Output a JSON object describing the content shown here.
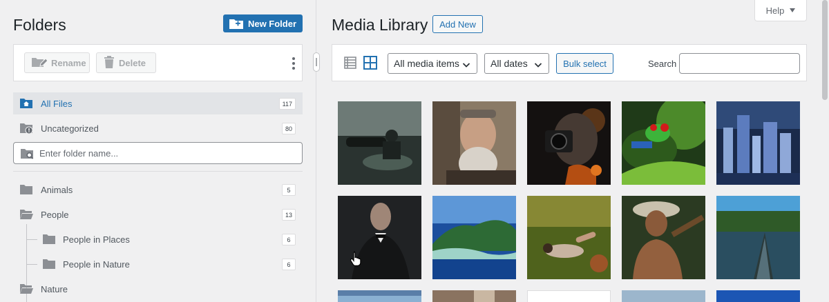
{
  "folders": {
    "title": "Folders",
    "new_folder_label": "New Folder",
    "toolbar": {
      "rename_label": "Rename",
      "delete_label": "Delete"
    },
    "all_files": {
      "label": "All Files",
      "count": "117"
    },
    "uncategorized": {
      "label": "Uncategorized",
      "count": "80"
    },
    "folder_name_placeholder": "Enter folder name...",
    "tree": [
      {
        "label": "Animals",
        "count": "5"
      },
      {
        "label": "People",
        "count": "13"
      },
      {
        "label": "People in Places",
        "count": "6"
      },
      {
        "label": "People in Nature",
        "count": "6"
      },
      {
        "label": "Nature",
        "count": ""
      }
    ]
  },
  "media": {
    "title": "Media Library",
    "add_new_label": "Add New",
    "help_label": "Help",
    "filters": {
      "media_type": "All media items",
      "dates": "All dates"
    },
    "bulk_select_label": "Bulk select",
    "search_label": "Search",
    "search_value": "",
    "thumbnails": [
      "photographer-on-lake",
      "bearded-man-portrait",
      "man-with-camera-fire",
      "red-eyed-tree-frog",
      "city-skyline-night",
      "man-in-tuxedo",
      "island-coastline",
      "woman-lying-in-grass",
      "man-with-straw-hat",
      "boat-on-river",
      "mountain-sky",
      "hands-raised",
      "white-image",
      "cloudy-sky",
      "blue-sky"
    ]
  },
  "colors": {
    "accent": "#2271b1",
    "background": "#f0f0f1",
    "selected_row": "#e2e4e7"
  }
}
